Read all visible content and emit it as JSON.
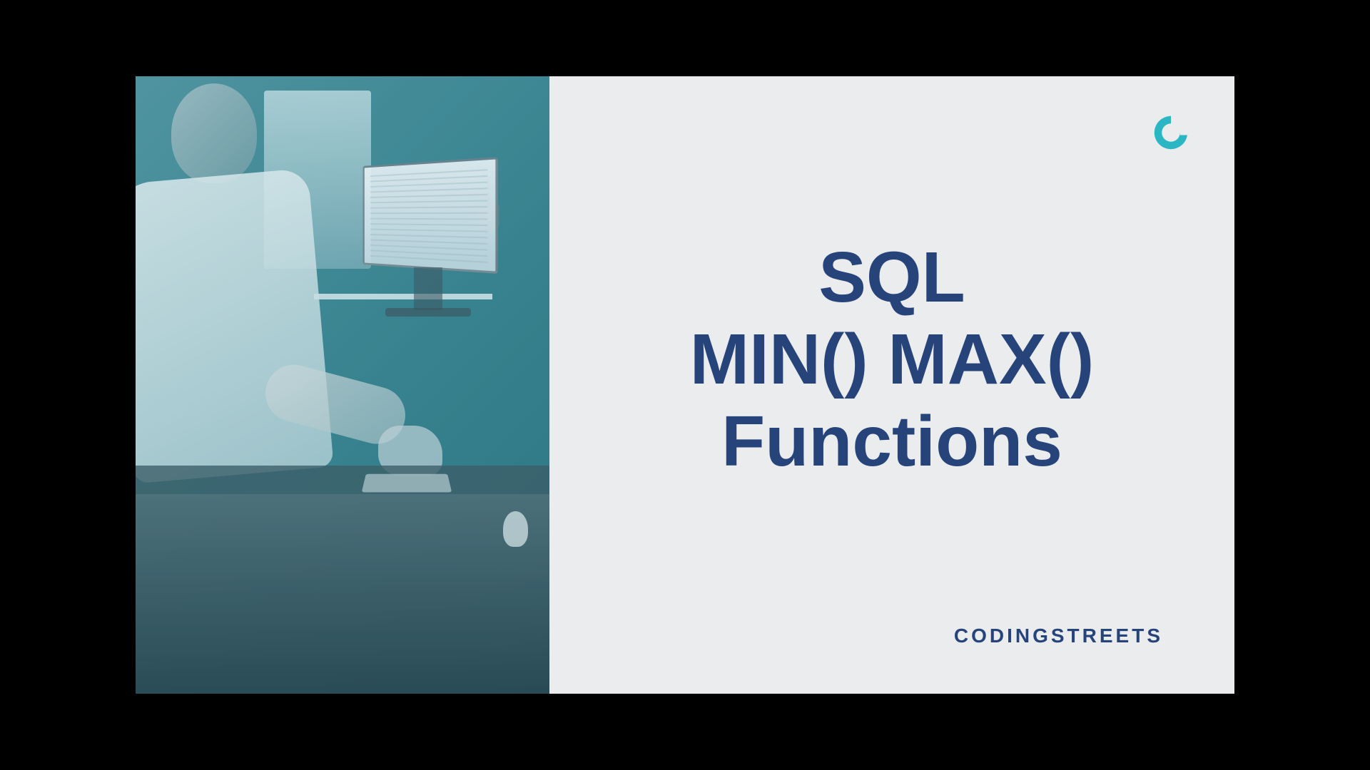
{
  "title": {
    "line1": "SQL",
    "line2": "MIN() MAX()",
    "line3": "Functions"
  },
  "brand": "CODINGSTREETS",
  "colors": {
    "accent": "#2bb6c4",
    "text": "#27447a",
    "background": "#eaecee"
  },
  "logo": {
    "name": "codingstreets-logo"
  }
}
